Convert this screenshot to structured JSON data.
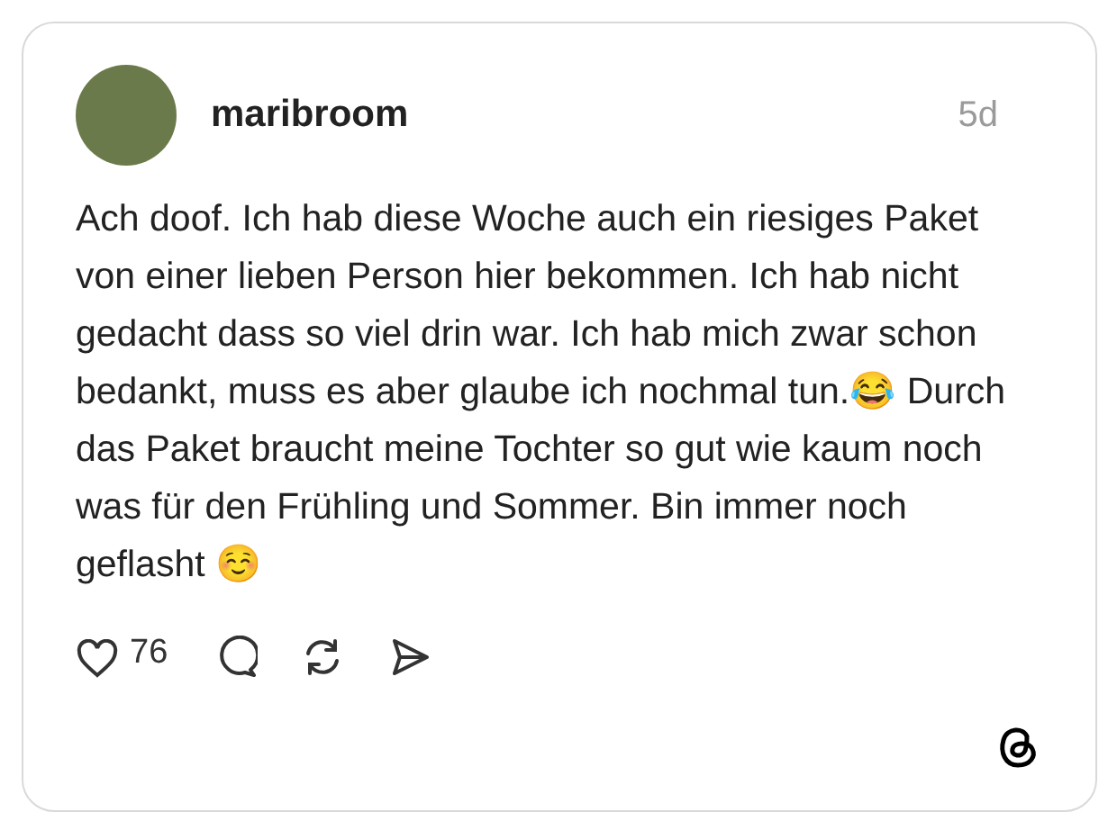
{
  "post": {
    "username": "maribroom",
    "time": "5d",
    "text": "Ach doof. Ich hab diese Woche auch ein riesiges Paket von einer lieben Person hier bekommen. Ich hab nicht gedacht dass so viel drin war. Ich hab mich zwar schon bedankt, muss es aber glaube ich nochmal tun.😂 Durch das Paket braucht meine Tochter so gut wie kaum noch was für den Frühling und Sommer. Bin immer noch geflasht ☺️",
    "likes": "76"
  }
}
